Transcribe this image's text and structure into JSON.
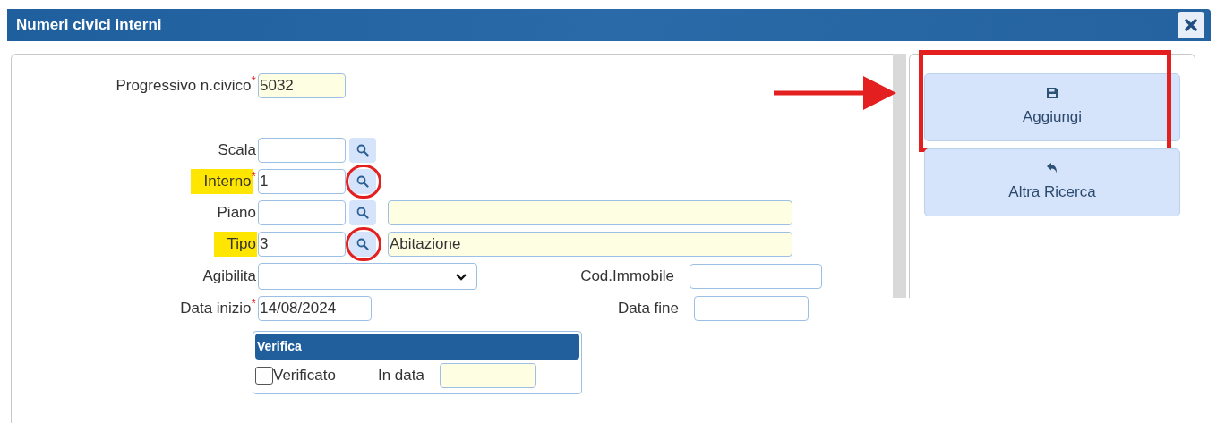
{
  "window": {
    "title": "Numeri civici interni"
  },
  "rows": [
    {
      "kind": "text",
      "label": "Progressivo n.civico",
      "required_mark": "*",
      "highlighted": false,
      "value": "5032",
      "readonly": true
    },
    {
      "kind": "lookup",
      "label": "Scala",
      "highlighted": false,
      "readonly": false,
      "lookup": {
        "circled": false
      }
    },
    {
      "kind": "lookup",
      "label": "Interno",
      "required_mark": "*",
      "highlighted": true,
      "value": "1",
      "readonly": false,
      "lookup": {
        "circled": true
      }
    },
    {
      "kind": "lookup",
      "label": "Piano",
      "highlighted": false,
      "readonly": false,
      "lookup": {
        "circled": false
      },
      "description": {
        "readonly": true
      }
    },
    {
      "kind": "lookup",
      "label": "Tipo",
      "highlighted": true,
      "value": "3",
      "readonly": false,
      "lookup": {
        "circled": true
      },
      "description": {
        "readonly": true,
        "value": "Abitazione"
      }
    },
    {
      "kind": "select",
      "label": "Agibilita",
      "highlighted": false,
      "readonly": false,
      "side": {
        "label": "Cod.Immobile",
        "readonly": false
      }
    },
    {
      "kind": "date",
      "label": "Data inizio",
      "required_mark": "*",
      "highlighted": false,
      "value": "14/08/2024",
      "readonly": false,
      "side": {
        "label": "Data fine",
        "readonly": false
      }
    }
  ],
  "verifica": {
    "title": "Verifica",
    "checkbox": {
      "label": "Verificato",
      "checked": false
    },
    "date": {
      "label": "In data",
      "readonly": true
    }
  },
  "actions": [
    {
      "kind": "save",
      "label": "Aggiungi",
      "annotated": true
    },
    {
      "kind": "back",
      "label": "Altra Ricerca",
      "annotated": false
    }
  ]
}
